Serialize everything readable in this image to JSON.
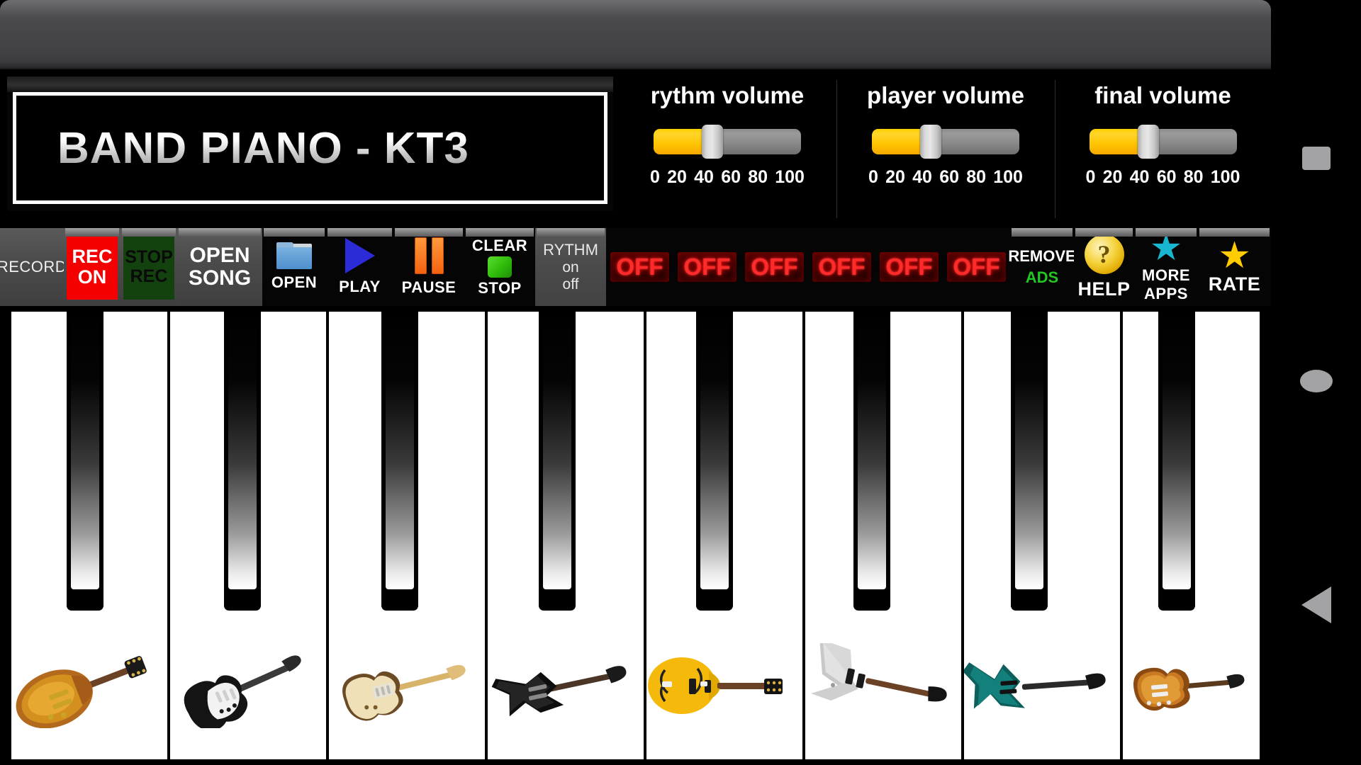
{
  "app": {
    "title": "BAND PIANO - KT3"
  },
  "volumes": [
    {
      "label": "rythm volume",
      "value": 40,
      "ticks": [
        "0",
        "20",
        "40",
        "60",
        "80",
        "100"
      ]
    },
    {
      "label": "player volume",
      "value": 40,
      "ticks": [
        "0",
        "20",
        "40",
        "60",
        "80",
        "100"
      ]
    },
    {
      "label": "final volume",
      "value": 40,
      "ticks": [
        "0",
        "20",
        "40",
        "60",
        "80",
        "100"
      ]
    }
  ],
  "toolbar": {
    "record_label": "RECORD",
    "rec_on_line1": "REC",
    "rec_on_line2": "ON",
    "stop_rec_line1": "STOP",
    "stop_rec_line2": "REC",
    "open_song_line1": "OPEN",
    "open_song_line2": "SONG",
    "open_label": "OPEN",
    "play_label": "PLAY",
    "pause_label": "PAUSE",
    "clear_label": "CLEAR",
    "stop_label": "STOP",
    "rythm_title": "RYTHM",
    "rythm_on": "on",
    "rythm_off": "off",
    "remove_label": "REMOVE",
    "ads_label": "ADS",
    "help_label": "HELP",
    "help_glyph": "?",
    "more_label": "MORE",
    "apps_label": "APPS",
    "rate_label": "RATE",
    "star_glyph": "★"
  },
  "channels": {
    "states": [
      "OFF",
      "OFF",
      "OFF",
      "OFF",
      "OFF",
      "OFF"
    ]
  },
  "colors": {
    "rec_on_bg": "#f50000",
    "stop_rec_bg": "#14420e",
    "off_led": "#ff2a2a",
    "ads_green": "#22c822",
    "slider_fill": "#ffc400",
    "play_blue": "#2b2bd8",
    "pause_orange": "#f4620f",
    "clear_green": "#2fbb0a",
    "more_apps_star": "#18b6cf",
    "rate_star": "#ffcc00"
  },
  "keyboard": {
    "white_key_count": 8,
    "black_key_count": 8,
    "guitars": [
      "sunburst-les-paul",
      "black-stratocaster",
      "natural-stratocaster",
      "black-explorer",
      "yellow-hollowbody",
      "silver-flying-v",
      "teal-warlock",
      "sunburst-mustang"
    ]
  },
  "navbar": {
    "recents": "recents-square",
    "home": "home-circle",
    "back": "back-triangle"
  }
}
